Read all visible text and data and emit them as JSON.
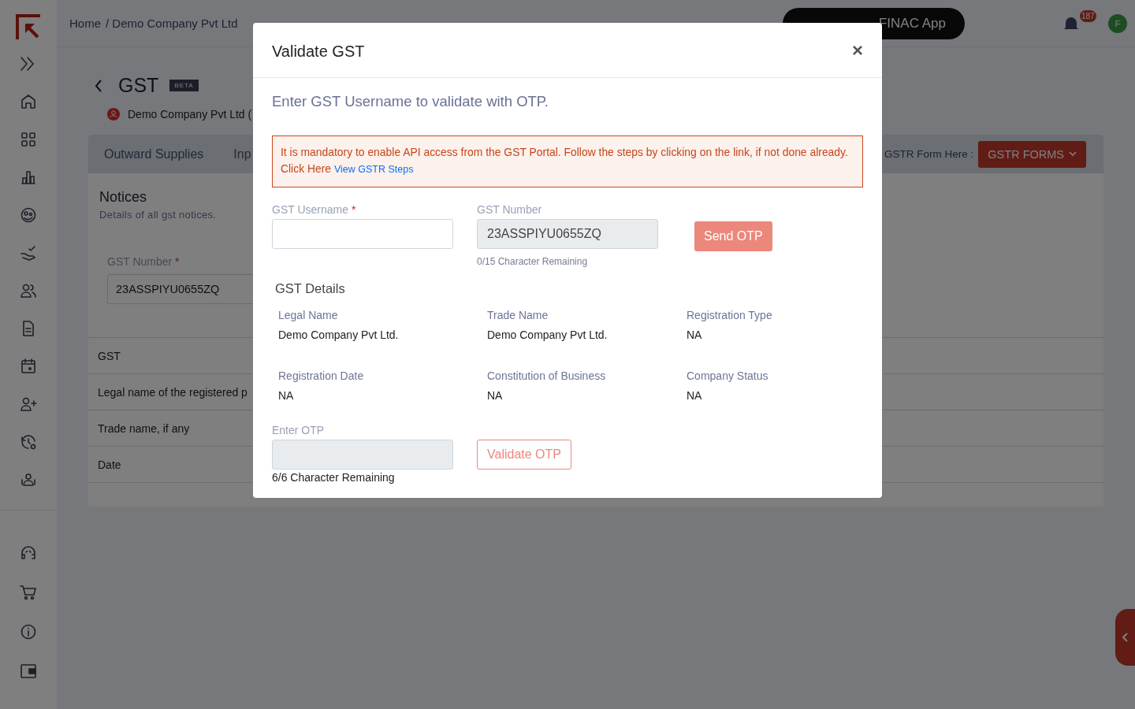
{
  "topbar": {
    "breadcrumb": [
      "Home",
      "/ Demo Company Pvt Ltd"
    ],
    "app_button": "FINAC App",
    "notification_count": "187",
    "avatar": "F"
  },
  "page": {
    "title": "GST",
    "badge": "BETA",
    "company": "Demo Company Pvt Ltd (",
    "tabs": [
      "Outward Supplies",
      "Inp"
    ],
    "gstr_label": "GSTR Form Here :",
    "gstr_button": "GSTR FORMS",
    "notices": {
      "title": "Notices",
      "subtitle": "Details of all gst notices.",
      "field_label": "GST Number",
      "required_mark": "*",
      "field_value": "23ASSPIYU0655ZQ"
    },
    "table_rows": [
      "GST",
      "Legal name of the registered p",
      "Trade name, if any",
      "Date"
    ]
  },
  "modal": {
    "title": "Validate GST",
    "close": "×",
    "intro": "Enter GST Username to validate with OTP.",
    "alert": {
      "text": "It is mandatory to enable API access from the GST Portal. Follow the steps by clicking on the link, if not done already. Click Here",
      "link": "View GSTR Steps"
    },
    "username": {
      "label": "GST Username",
      "required_mark": "*"
    },
    "gst_number": {
      "label": "GST Number",
      "value": "23ASSPIYU0655ZQ",
      "disabled": true,
      "hint": "0/15 Character Remaining"
    },
    "send_button": {
      "label": "Send OTP",
      "disabled": true
    },
    "details_title": "GST Details",
    "details": [
      {
        "label": "Legal Name",
        "value": "Demo Company Pvt Ltd."
      },
      {
        "label": "Trade Name",
        "value": "Demo Company Pvt Ltd."
      },
      {
        "label": "Registration Type",
        "value": "NA"
      },
      {
        "label": "Registration Date",
        "value": "NA"
      },
      {
        "label": "Constitution of Business",
        "value": "NA"
      },
      {
        "label": "Company Status",
        "value": "NA"
      }
    ],
    "otp": {
      "label": "Enter OTP",
      "disabled": true,
      "hint": "6/6 Character Remaining"
    },
    "validate_button": {
      "label": "Validate OTP"
    }
  }
}
